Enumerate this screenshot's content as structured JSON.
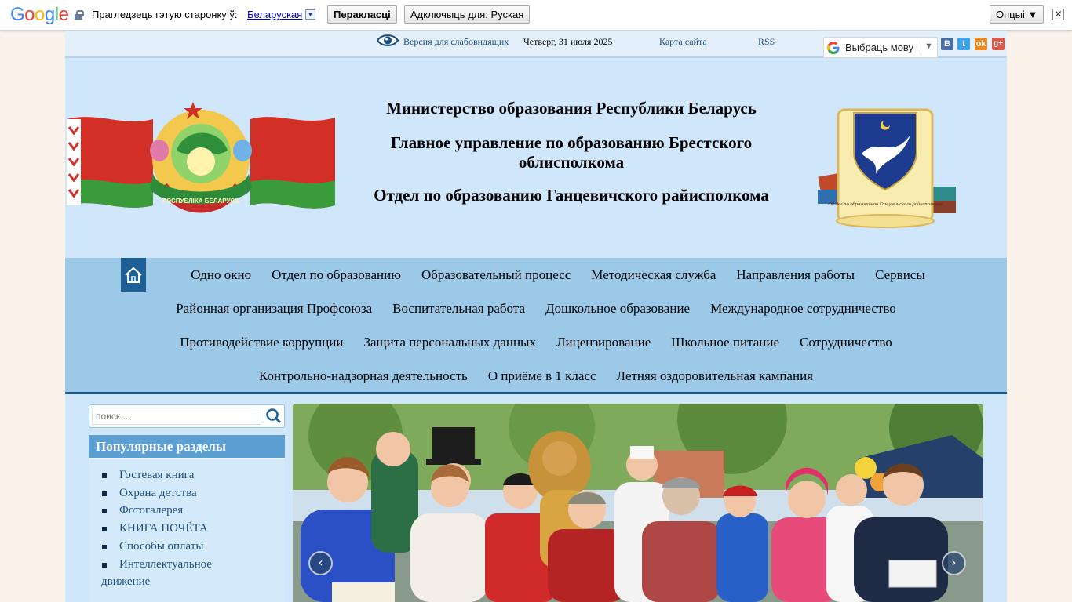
{
  "translate_bar": {
    "logo": [
      "G",
      "o",
      "o",
      "g",
      "l",
      "e"
    ],
    "prompt": "Прагледзець гэтую старонку ў:",
    "language": "Беларуская",
    "dropdown_glyph": "▼",
    "translate_button": "Перакласці",
    "disable_button": "Адключыць для: Руская",
    "options_button": "Опцыі ▼",
    "close_glyph": "✕"
  },
  "topline": {
    "visually_impaired": "Версия для слабовидящих",
    "date": "Четверг, 31 июля 2025",
    "sitemap": "Карта сайта",
    "rss": "RSS",
    "language_select": "Выбраць мову",
    "language_arrow": "▼",
    "social": [
      "В",
      "t",
      "ok",
      "g+"
    ]
  },
  "header": {
    "line1": "Министерство образования Республики Беларусь",
    "line2": "Главное управление по образованию Брестского облисполкома",
    "line3": "Отдел по образованию Ганцевичского райисполкома",
    "emblem_ribbon": "РЭСПУБЛІКА БЕЛАРУСЬ",
    "dept_scroll": "Отдел по образованию Ганцевичского райисполкома"
  },
  "nav": {
    "row1": [
      "Одно окно",
      "Отдел по образованию",
      "Образовательный процесс",
      "Методическая служба",
      "Направления работы",
      "Сервисы"
    ],
    "row2": [
      "Районная организация Профсоюза",
      "Воспитательная работа",
      "Дошкольное образование",
      "Международное сотрудничество"
    ],
    "row3": [
      "Противодействие коррупции",
      "Защита персональных данных",
      "Лицензирование",
      "Школьное питание",
      "Сотрудничество"
    ],
    "row4": [
      "Контрольно-надзорная деятельность",
      "О приёме в 1 класс",
      "Летняя оздоровительная кампания"
    ]
  },
  "search": {
    "placeholder": "поиск ..."
  },
  "popular": {
    "title": "Популярные разделы",
    "items": [
      "Гостевая книга",
      "Охрана детства",
      "Фотогалерея",
      "КНИГА ПОЧЁТА",
      "Способы оплаты"
    ],
    "wrapped_item": {
      "first": "Интеллектуальное",
      "second": "движение"
    }
  },
  "slider": {
    "prev": "‹",
    "next": "›"
  },
  "colors": {
    "header_bg": "#cfe6fb",
    "nav_bg": "#9dc9e9",
    "accent": "#1e5f95",
    "link": "#1c4f7d"
  }
}
